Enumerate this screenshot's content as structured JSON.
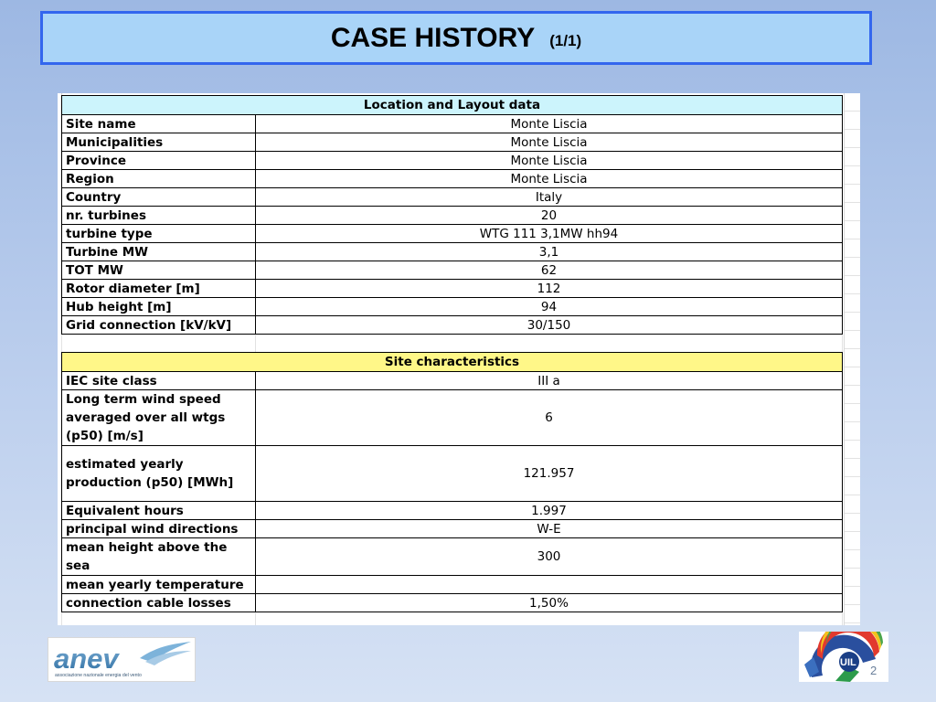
{
  "slide": {
    "title": "CASE HISTORY",
    "title_suffix": "(1/1)",
    "page_number": "2"
  },
  "table": {
    "section1_title": "Location and Layout data",
    "section1_rows": [
      {
        "label": "Site name",
        "value": "Monte Liscia"
      },
      {
        "label": "Municipalities",
        "value": "Monte Liscia"
      },
      {
        "label": "Province",
        "value": "Monte Liscia"
      },
      {
        "label": "Region",
        "value": "Monte Liscia"
      },
      {
        "label": "Country",
        "value": "Italy"
      },
      {
        "label": "nr. turbines",
        "value": "20"
      },
      {
        "label": "turbine type",
        "value": "WTG 111 3,1MW hh94"
      },
      {
        "label": "Turbine MW",
        "value": "3,1"
      },
      {
        "label": "TOT MW",
        "value": "62"
      },
      {
        "label": "Rotor diameter [m]",
        "value": "112"
      },
      {
        "label": "Hub height [m]",
        "value": "94"
      },
      {
        "label": "Grid connection [kV/kV]",
        "value": "30/150"
      }
    ],
    "section2_title": "Site characteristics",
    "section2_rows": [
      {
        "label": "IEC site class",
        "value": "III a"
      },
      {
        "label": "Long term wind speed averaged over all wtgs (p50) [m/s]",
        "value": "6"
      },
      {
        "label": "estimated yearly production (p50) [MWh]",
        "value": "121.957"
      },
      {
        "label": "Equivalent hours",
        "value": "1.997"
      },
      {
        "label": "principal wind directions",
        "value": "W-E"
      },
      {
        "label": "mean height above the sea",
        "value": "300"
      },
      {
        "label": "mean yearly temperature",
        "value": ""
      },
      {
        "label": "connection cable losses",
        "value": "1,50%"
      }
    ]
  },
  "logos": {
    "left_brand": "anev",
    "left_tagline": "associazione nazionale energia del vento",
    "right_brand": "UIL"
  },
  "colors": {
    "title_box_bg": "#a9d4f8",
    "title_box_border": "#3366ee",
    "section1_header_bg": "#ccf4fc",
    "section2_header_bg": "#fff788"
  }
}
